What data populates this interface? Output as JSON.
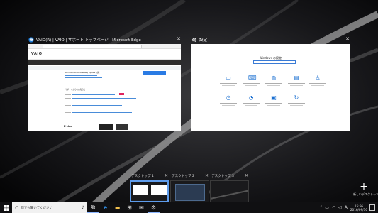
{
  "windows": [
    {
      "title": "VAIO(R) | VAIO | サポート トップページ - Microsoft Edge",
      "close": "✕",
      "icon": "edge-icon",
      "page": {
        "logo": "VAIO",
        "heading": "Windows 10 Anniversary Update 対応",
        "section": "サポートからのお知らせ",
        "brand": "Z Line"
      }
    },
    {
      "title": "設定",
      "close": "✕",
      "icon": "gear-icon",
      "page": {
        "heading": "Windows の設定"
      }
    }
  ],
  "desktops": [
    {
      "label": "デスクトップ 1",
      "close": "✕",
      "active": true
    },
    {
      "label": "デスクトップ 2",
      "close": "✕",
      "active": false
    },
    {
      "label": "デスクトップ 3",
      "close": "✕",
      "active": false
    }
  ],
  "new_desktop": {
    "icon": "+",
    "label": "新しいデスクトップ"
  },
  "taskbar": {
    "search_placeholder": "何でも聞いてください",
    "time": "15:56",
    "date": "2016/09/30"
  },
  "colors": {
    "accent": "#5e9cec",
    "settings_icon": "#1a6fd1",
    "taskbar": "#101012"
  }
}
